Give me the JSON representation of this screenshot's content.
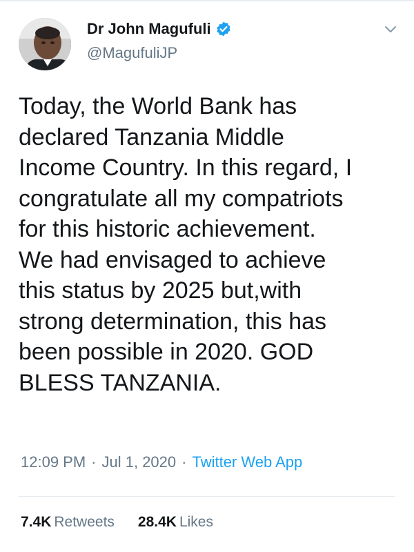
{
  "author": {
    "name": "Dr John Magufuli",
    "handle": "@MagufuliJP",
    "verified": true
  },
  "tweet": {
    "text": "Today, the World Bank has\ndeclared Tanzania Middle\nIncome Country. In this regard, I\ncongratulate all my compatriots\nfor this historic achievement.\nWe had envisaged to achieve\nthis status by 2025 but,with\nstrong determination, this has\nbeen possible in 2020. GOD\nBLESS TANZANIA.",
    "time": "12:09 PM",
    "date": "Jul 1, 2020",
    "separator": "·",
    "source": "Twitter Web App"
  },
  "stats": {
    "retweets_count": "7.4K",
    "retweets_label": "Retweets",
    "likes_count": "28.4K",
    "likes_label": "Likes"
  },
  "colors": {
    "text": "#14171a",
    "secondary": "#657786",
    "accent": "#1da1f2",
    "divider": "#e6ecf0"
  }
}
